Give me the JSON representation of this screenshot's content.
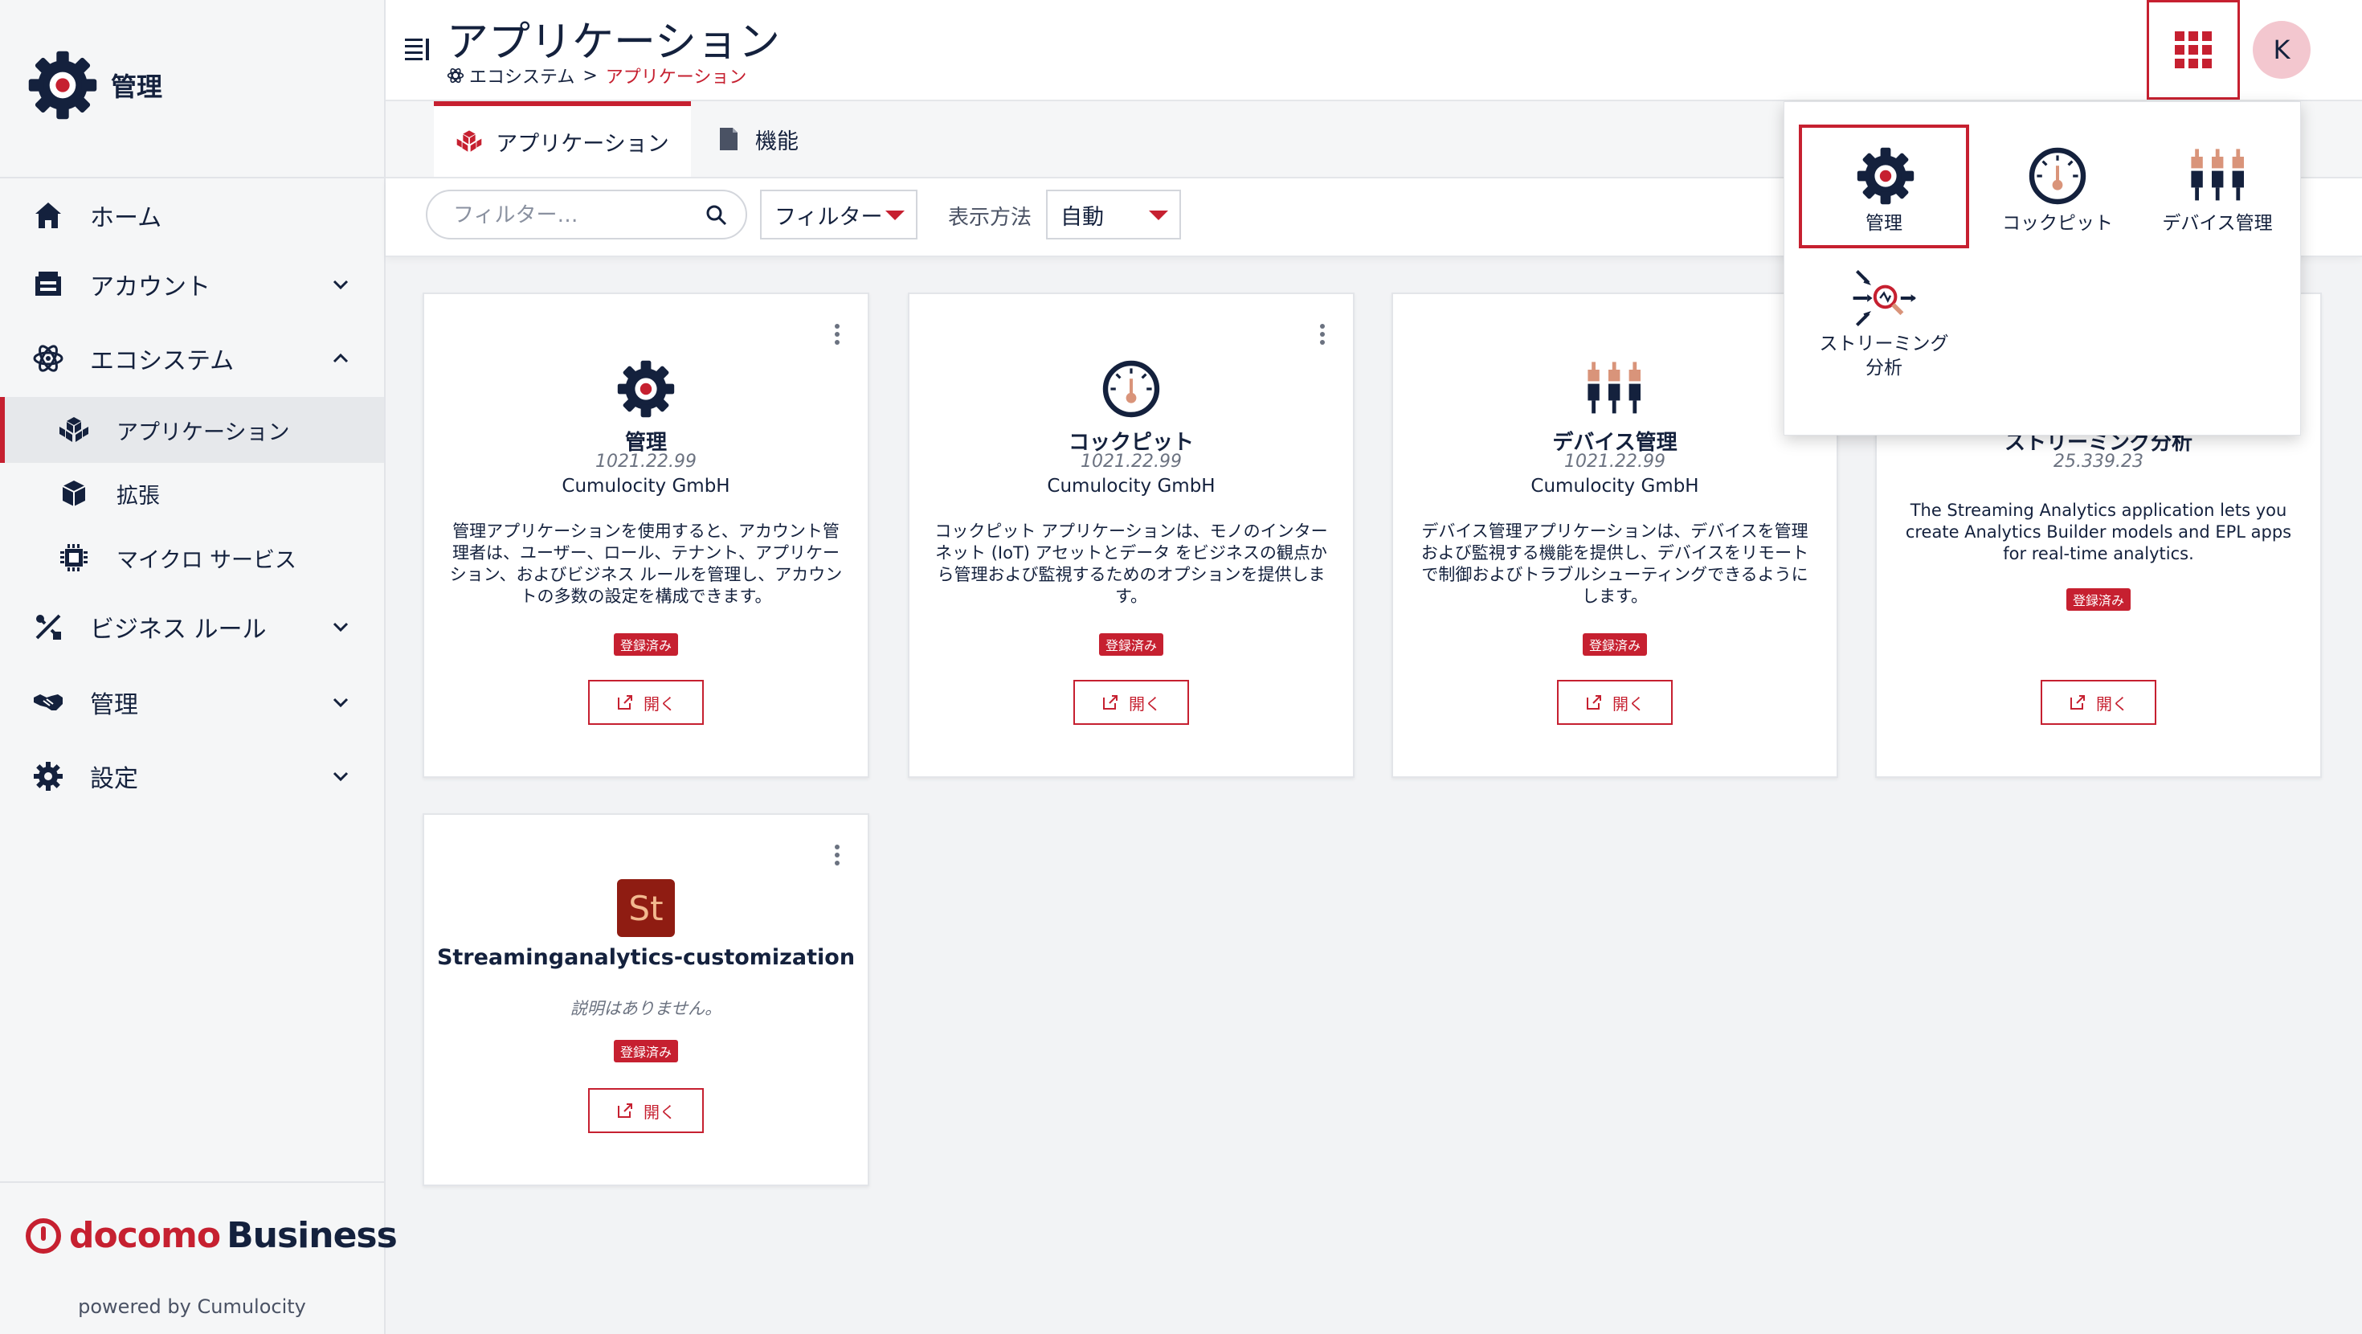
{
  "app": {
    "title": "管理"
  },
  "sidebar": {
    "items": [
      {
        "label": "ホーム"
      },
      {
        "label": "アカウント"
      },
      {
        "label": "エコシステム"
      },
      {
        "label": "アプリケーション"
      },
      {
        "label": "拡張"
      },
      {
        "label": "マイクロ サービス"
      },
      {
        "label": "ビジネス ルール"
      },
      {
        "label": "管理"
      },
      {
        "label": "設定"
      }
    ],
    "footer": {
      "logo_part1": "docomo",
      "logo_part2": "Business",
      "powered_by": "powered by Cumulocity"
    }
  },
  "header": {
    "page_title": "アプリケーション",
    "breadcrumb": [
      "エコシステム",
      "アプリケーション"
    ],
    "breadcrumb_sep": ">",
    "avatar_initial": "K"
  },
  "tabs": [
    {
      "label": "アプリケーション"
    },
    {
      "label": "機能"
    }
  ],
  "toolbar": {
    "search_placeholder": "フィルター…",
    "filter_select": "フィルター",
    "view_label": "表示方法",
    "view_select": "自動"
  },
  "cards": [
    {
      "name": "管理",
      "version": "1021.22.99",
      "vendor": "Cumulocity GmbH",
      "description": "管理アプリケーションを使用すると、アカウント管理者は、ユーザー、ロール、テナント、アプリケーション、およびビジネス ルールを管理し、アカウントの多数の設定を構成できます。",
      "badge": "登録済み",
      "open": "開く",
      "icon": "gear-icon"
    },
    {
      "name": "コックピット",
      "version": "1021.22.99",
      "vendor": "Cumulocity GmbH",
      "description": "コックピット アプリケーションは、モノのインターネット (IoT) アセットとデータ をビジネスの観点から管理および監視するためのオプションを提供します。",
      "badge": "登録済み",
      "open": "開く",
      "icon": "gauge-icon"
    },
    {
      "name": "デバイス管理",
      "version": "1021.22.99",
      "vendor": "Cumulocity GmbH",
      "description": "デバイス管理アプリケーションは、デバイスを管理および監視する機能を提供し、デバイスをリモートで制御およびトラブルシューティングできるようにします。",
      "badge": "登録済み",
      "open": "開く",
      "icon": "device-icon"
    },
    {
      "name": "ストリーミング分析",
      "version": "25.339.23",
      "vendor": "",
      "description": "The Streaming Analytics application lets you create Analytics Builder models and EPL apps for real-time analytics.",
      "badge": "登録済み",
      "open": "開く",
      "icon": "streaming-icon"
    },
    {
      "name": "Streaminganalytics-customization",
      "version": "",
      "vendor": "",
      "description": "説明はありません。",
      "badge": "登録済み",
      "open": "開く",
      "icon": "st-icon",
      "icon_text": "St"
    }
  ],
  "app_switcher": {
    "items": [
      {
        "label": "管理",
        "icon": "gear-icon",
        "selected": true
      },
      {
        "label": "コックピット",
        "icon": "gauge-icon"
      },
      {
        "label": "デバイス管理",
        "icon": "device-icon"
      },
      {
        "label": "ストリーミング\n分析",
        "icon": "streaming-icon"
      }
    ]
  },
  "colors": {
    "accent": "#c62030",
    "navy": "#14213d",
    "device_top": "#d9947a"
  }
}
